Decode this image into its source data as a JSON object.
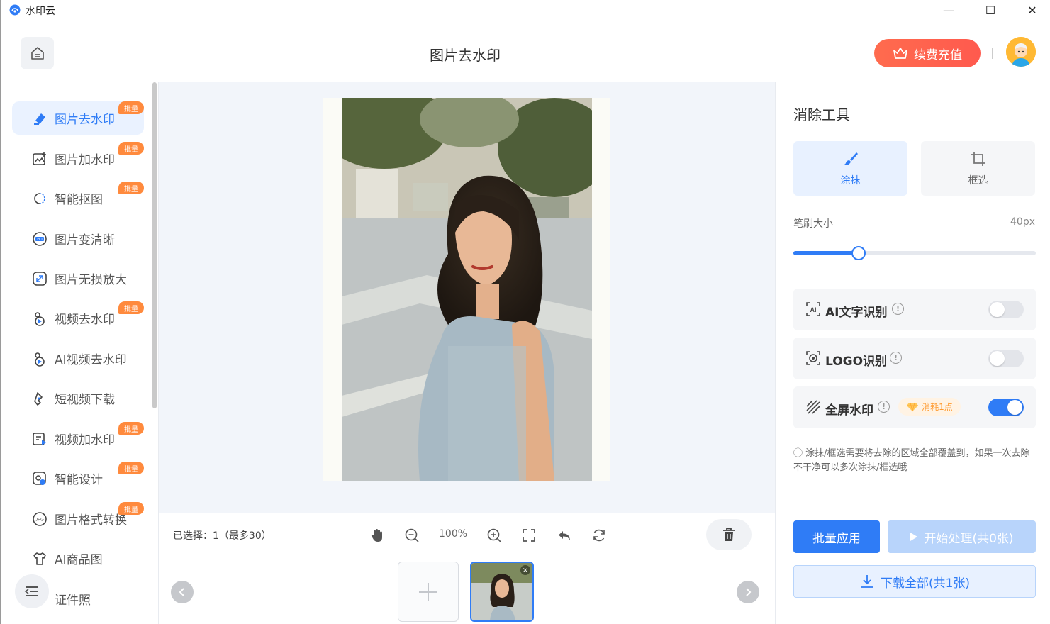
{
  "app": {
    "title": "水印云"
  },
  "window_controls": {
    "minimize": "—",
    "maximize": "☐",
    "close": "✕"
  },
  "header": {
    "page_title": "图片去水印",
    "renew_label": "续费充值",
    "home_icon": "home-icon",
    "avatar_icon": "user-avatar"
  },
  "sidebar": {
    "items": [
      {
        "label": "图片去水印",
        "icon": "eraser-icon",
        "badge": "批量",
        "active": true
      },
      {
        "label": "图片加水印",
        "icon": "image-add-icon",
        "badge": "批量"
      },
      {
        "label": "智能抠图",
        "icon": "cutout-icon",
        "badge": "批量"
      },
      {
        "label": "图片变清晰",
        "icon": "hd-icon"
      },
      {
        "label": "图片无损放大",
        "icon": "enlarge-icon"
      },
      {
        "label": "视频去水印",
        "icon": "video-eraser-icon",
        "badge": "批量"
      },
      {
        "label": "AI视频去水印",
        "icon": "ai-video-icon"
      },
      {
        "label": "短视频下载",
        "icon": "download-link-icon"
      },
      {
        "label": "视频加水印",
        "icon": "video-add-icon",
        "badge": "批量"
      },
      {
        "label": "智能设计",
        "icon": "design-icon",
        "badge": "批量"
      },
      {
        "label": "图片格式转换",
        "icon": "jpg-icon",
        "badge": "批量"
      },
      {
        "label": "AI商品图",
        "icon": "shirt-icon"
      },
      {
        "label": "证件照",
        "icon": "id-photo-icon"
      }
    ]
  },
  "toolbar": {
    "selected_text": "已选择：1（最多30）",
    "zoom": "100%",
    "tools": [
      "hand-icon",
      "zoom-out-icon",
      "zoom-in-icon",
      "fit-screen-icon",
      "undo-icon",
      "reset-icon"
    ]
  },
  "panel": {
    "title": "消除工具",
    "modes": [
      {
        "label": "涂抹",
        "icon": "brush-icon",
        "active": true
      },
      {
        "label": "框选",
        "icon": "crop-icon",
        "active": false
      }
    ],
    "brush_label": "笔刷大小",
    "brush_value": "40px",
    "brush_fraction": 0.27,
    "options": [
      {
        "label": "AI文字识别",
        "icon": "ai-text-icon",
        "enabled": false
      },
      {
        "label": "LOGO识别",
        "icon": "logo-detect-icon",
        "enabled": false
      },
      {
        "label": "全屏水印",
        "icon": "fullscreen-watermark-icon",
        "enabled": true,
        "cost": "消耗1点"
      }
    ],
    "hint": "ⓘ 涂抹/框选需要将去除的区域全部覆盖到，如果一次去除不干净可以多次涂抹/框选哦",
    "batch_label": "批量应用",
    "start_label": "开始处理(共0张)",
    "download_label": "下载全部(共1张)"
  },
  "colors": {
    "accent": "#2f7cf6",
    "badge": "#ff8a3d",
    "renew": "#ff5a4e"
  }
}
